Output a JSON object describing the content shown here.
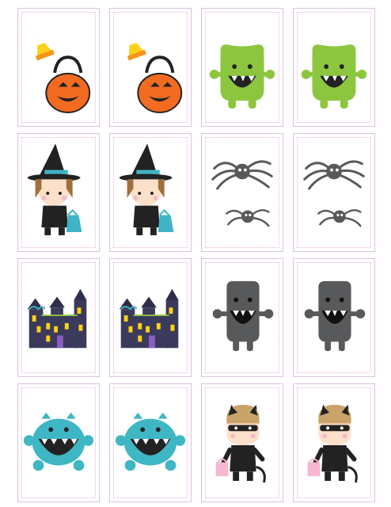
{
  "sheet": {
    "rows": [
      {
        "pair": "candy-corn-and-pumpkin-bucket",
        "cards": [
          "candy-corn-pumpkin",
          "candy-corn-pumpkin",
          "green-monster",
          "green-monster"
        ]
      },
      {
        "pair": "witch-and-spiders",
        "cards": [
          "witch",
          "witch",
          "spiders",
          "spiders"
        ]
      },
      {
        "pair": "haunted-house-and-grey-monster",
        "cards": [
          "haunted-house",
          "haunted-house",
          "grey-monster",
          "grey-monster"
        ]
      },
      {
        "pair": "blue-monster-and-cat-kid",
        "cards": [
          "blue-monster",
          "blue-monster",
          "cat-costume-kid",
          "cat-costume-kid"
        ]
      }
    ],
    "colors": {
      "card_border": "#d9c2e0",
      "dotted_border": "#e7b6dc",
      "pumpkin": "#f26b21",
      "green_monster": "#8cc63f",
      "witch_teal": "#3fb4c6",
      "grey_monster": "#58595b",
      "blue_monster": "#3fb6c4",
      "house": "#3b3a5c",
      "candy_yellow": "#fcd116",
      "bag_pink": "#f7b6d2"
    }
  }
}
